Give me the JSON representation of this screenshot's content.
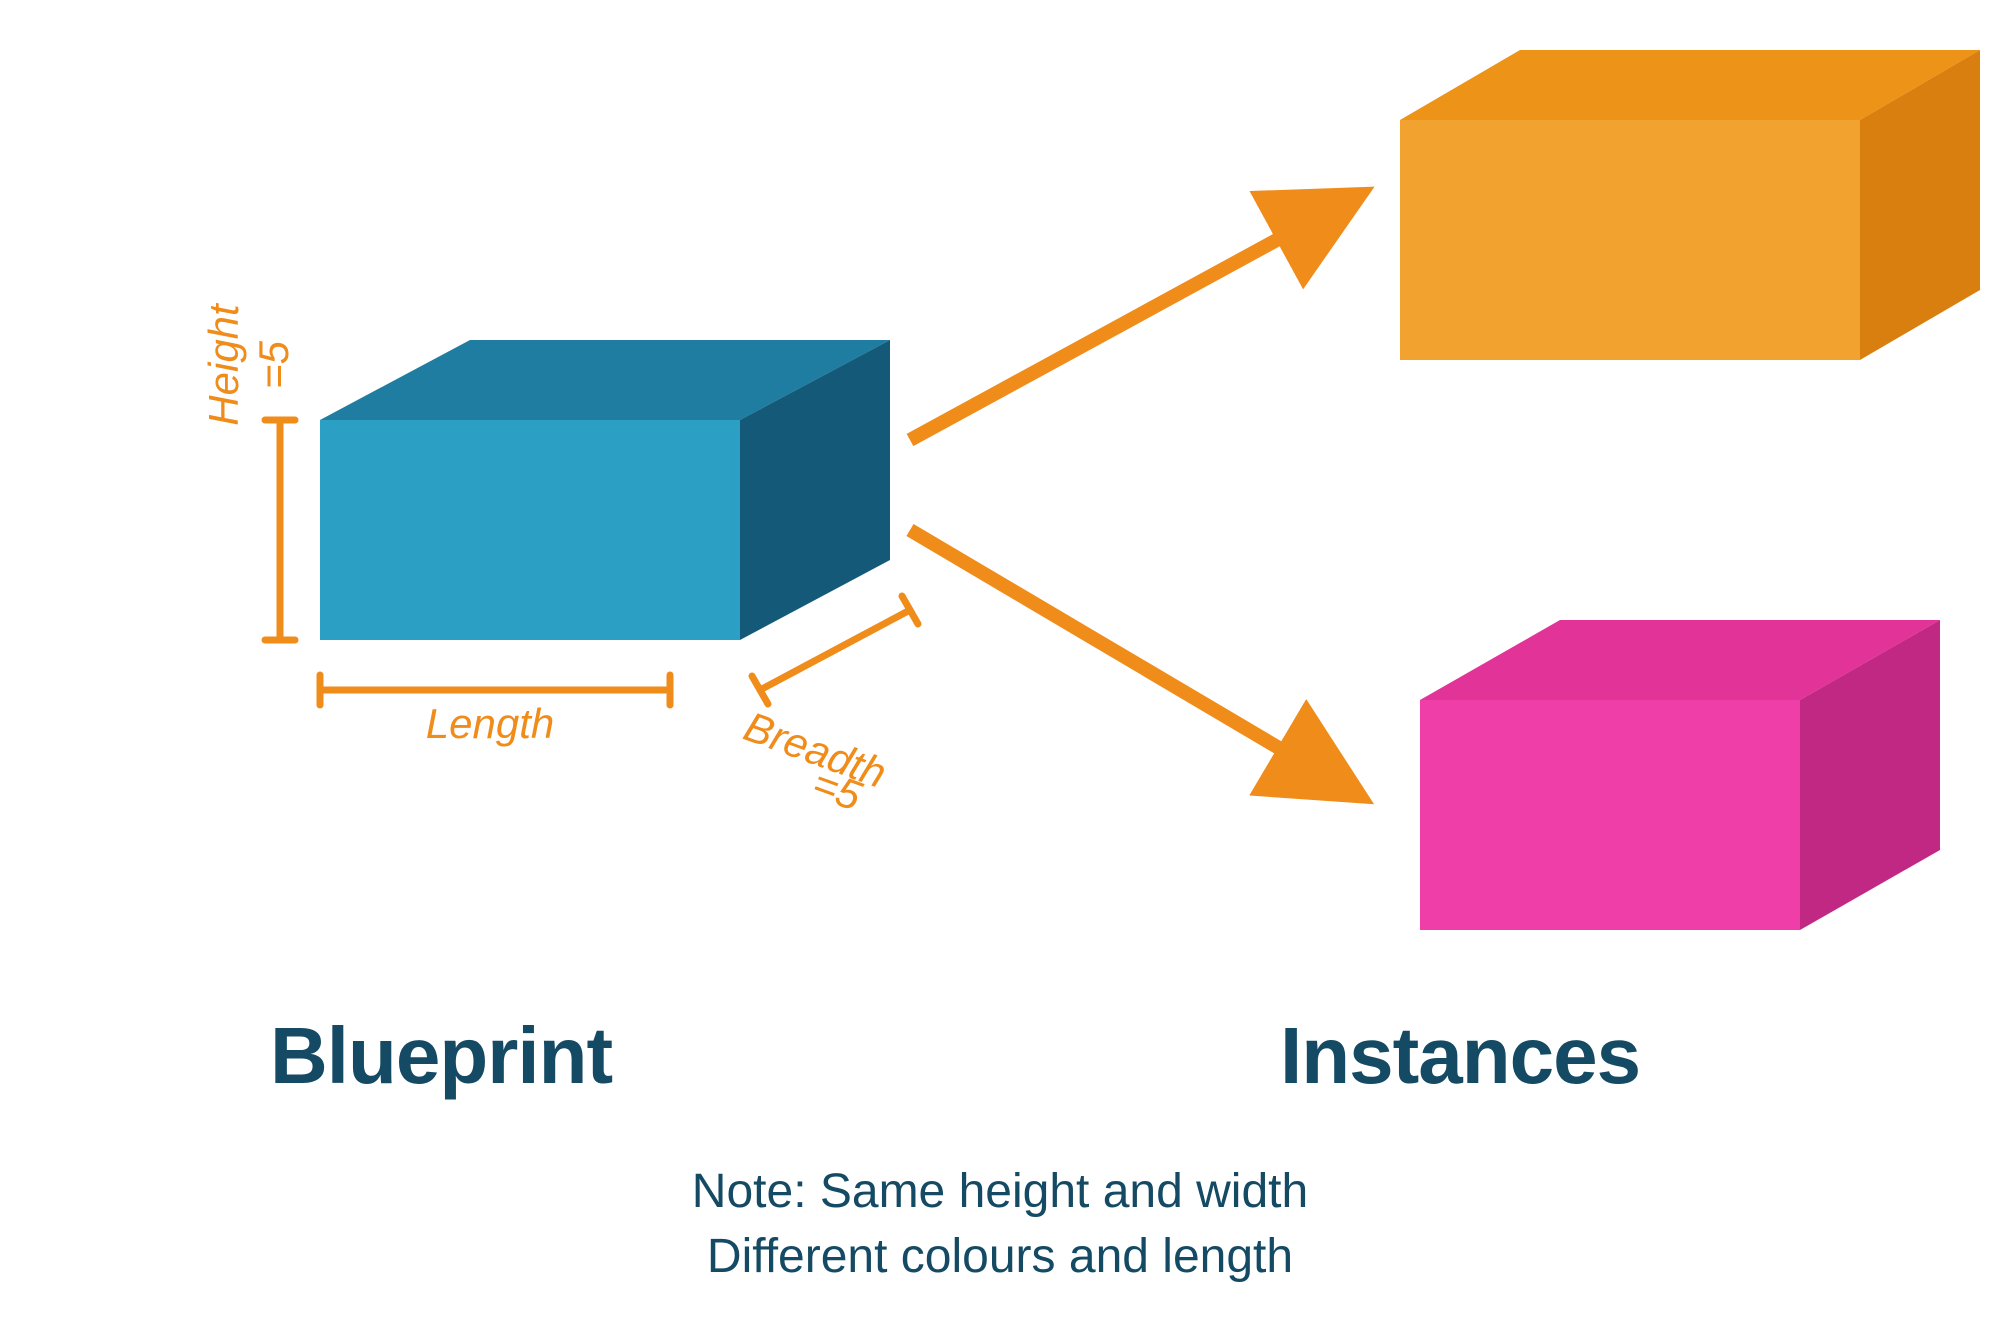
{
  "headings": {
    "left": "Blueprint",
    "right": "Instances"
  },
  "note": {
    "line1": "Note: Same height and width",
    "line2": "Different colours and length"
  },
  "dimensions": {
    "height_label": "Height",
    "height_value": "=5",
    "length_label": "Length",
    "breadth_label": "Breadth",
    "breadth_value": "=5"
  },
  "colors": {
    "blueprint_front": "#2ba0c4",
    "blueprint_top": "#1e7da0",
    "blueprint_side": "#145a78",
    "instance1_front": "#f2a22e",
    "instance1_top": "#ed9418",
    "instance1_side": "#d97f0f",
    "instance2_front": "#ef3ea8",
    "instance2_top": "#e23498",
    "instance2_side": "#c12884",
    "arrow": "#f08c1a",
    "measure": "#f08c1a",
    "heading": "#144a64"
  },
  "diagram": {
    "concept": "class-and-instances",
    "blueprint": {
      "height": 5,
      "breadth": 5,
      "length": "variable",
      "color": "blue"
    },
    "instances": [
      {
        "color": "orange",
        "height": 5,
        "breadth": 5
      },
      {
        "color": "pink",
        "height": 5,
        "breadth": 5
      }
    ]
  }
}
